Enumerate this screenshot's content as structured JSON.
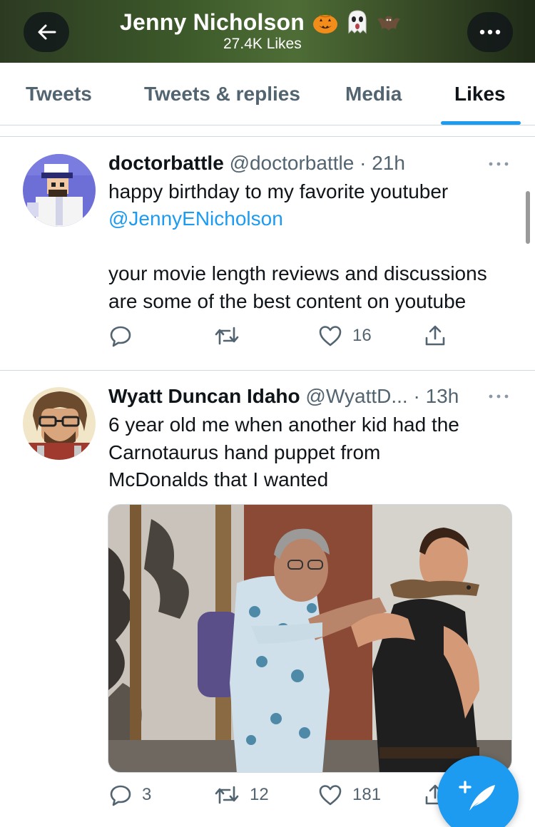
{
  "header": {
    "title": "Jenny Nicholson",
    "title_emoji": [
      "pumpkin-icon",
      "ghost-icon",
      "bat-icon"
    ],
    "subtitle": "27.4K Likes",
    "back_icon": "arrow-left-icon",
    "more_icon": "more-horizontal-icon",
    "background": "#3d5a2a"
  },
  "tabs": [
    {
      "label": "Tweets",
      "active": false
    },
    {
      "label": "Tweets & replies",
      "active": false
    },
    {
      "label": "Media",
      "active": false
    },
    {
      "label": "Likes",
      "active": true
    }
  ],
  "tweets": [
    {
      "name": "doctorbattle",
      "handle": "@doctorbattle",
      "time": "· 21h",
      "lines": [
        "happy birthday to my favorite youtuber",
        "@JennyENicholson",
        "your movie length reviews and discussions",
        "are some of the best content on youtube"
      ],
      "reply_count": "",
      "retweet_count": "",
      "like_count": "16"
    },
    {
      "name": "Wyatt Duncan Idaho",
      "handle": "@WyattD...",
      "time": "· 13h",
      "lines": [
        "6 year old me when another kid had the",
        "Carnotaurus hand puppet from",
        "McDonalds that I wanted"
      ],
      "reply_count": "3",
      "retweet_count": "12",
      "like_count": "181"
    }
  ],
  "fab": {
    "icon": "compose-tweet-icon",
    "symbol": "+"
  },
  "colors": {
    "accent": "#1d9bf0",
    "text": "#0f1419",
    "muted": "#536471",
    "border": "#cfd9de"
  }
}
